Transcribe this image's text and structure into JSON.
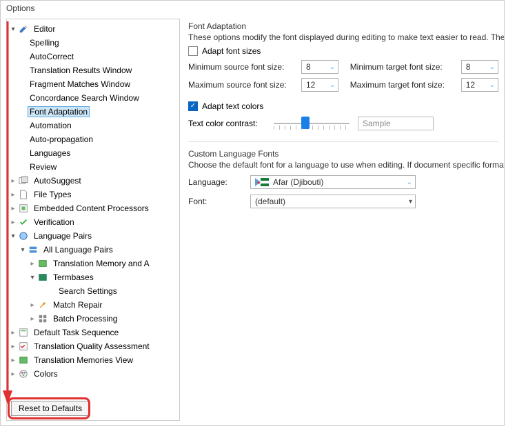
{
  "window": {
    "title": "Options"
  },
  "tree": {
    "editor": "Editor",
    "spelling": "Spelling",
    "autocorrect": "AutoCorrect",
    "translation_results_window": "Translation Results Window",
    "fragment_matches_window": "Fragment Matches Window",
    "concordance_search_window": "Concordance Search Window",
    "font_adaptation": "Font Adaptation",
    "automation": "Automation",
    "auto_propagation": "Auto-propagation",
    "languages": "Languages",
    "review": "Review",
    "autosuggest": "AutoSuggest",
    "file_types": "File Types",
    "embedded_content_processors": "Embedded Content Processors",
    "verification": "Verification",
    "language_pairs": "Language Pairs",
    "all_language_pairs": "All Language Pairs",
    "tm_and_a": "Translation Memory and A",
    "termbases": "Termbases",
    "search_settings": "Search Settings",
    "match_repair": "Match Repair",
    "batch_processing": "Batch Processing",
    "default_task_sequence": "Default Task Sequence",
    "translation_quality_assessment": "Translation Quality Assessment",
    "translation_memories_view": "Translation Memories View",
    "colors": "Colors"
  },
  "reset_button": "Reset to Defaults",
  "panel": {
    "font_adaptation_title": "Font Adaptation",
    "font_adaptation_desc": "These options modify the font displayed during editing to make text easier to read. They ha",
    "adapt_font_sizes": "Adapt font sizes",
    "min_source_label": "Minimum source font size:",
    "min_source_value": "8",
    "min_target_label": "Minimum target font size:",
    "min_target_value": "8",
    "max_source_label": "Maximum source font size:",
    "max_source_value": "12",
    "max_target_label": "Maximum target font size:",
    "max_target_value": "12",
    "adapt_text_colors": "Adapt text colors",
    "text_color_contrast": "Text color contrast:",
    "sample": "Sample",
    "custom_fonts_title": "Custom Language Fonts",
    "custom_fonts_desc": "Choose the default font for a language to use when editing. If document specific formattin",
    "language_label": "Language:",
    "language_value": "Afar (Djibouti)",
    "font_label": "Font:",
    "font_value": "(default)"
  }
}
